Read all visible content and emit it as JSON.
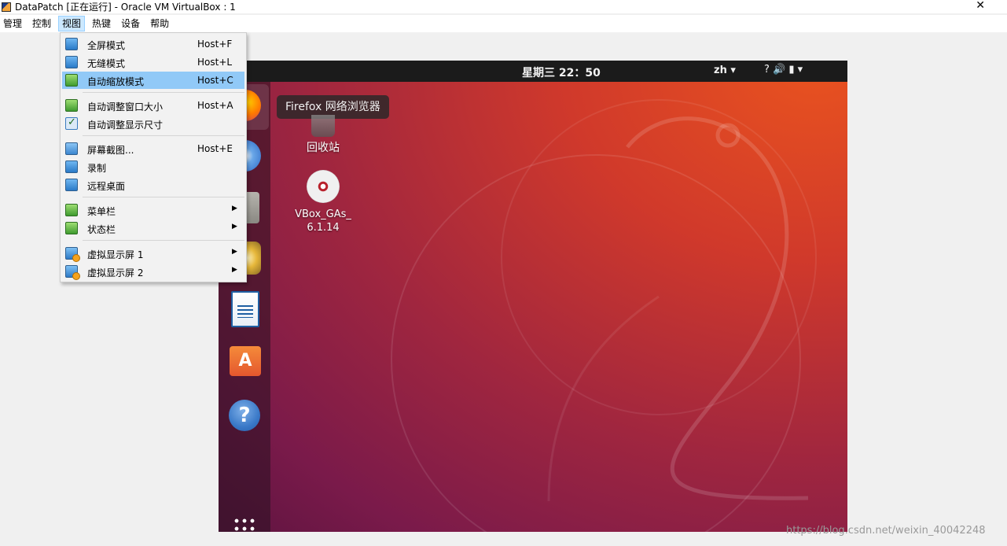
{
  "window": {
    "title": "DataPatch [正在运行] - Oracle VM VirtualBox : 1",
    "close_label": "✕"
  },
  "menubar": {
    "items": [
      "管理",
      "控制",
      "视图",
      "热键",
      "设备",
      "帮助"
    ]
  },
  "view_menu": {
    "items": [
      {
        "label": "全屏模式",
        "shortcut": "Host+F"
      },
      {
        "label": "无缝模式",
        "shortcut": "Host+L"
      },
      {
        "label": "自动缩放模式",
        "shortcut": "Host+C"
      },
      {
        "label": "自动调整窗口大小",
        "shortcut": "Host+A"
      },
      {
        "label": "自动调整显示尺寸",
        "shortcut": ""
      },
      {
        "label": "屏幕截图...",
        "shortcut": "Host+E"
      },
      {
        "label": "录制",
        "shortcut": ""
      },
      {
        "label": "远程桌面",
        "shortcut": ""
      },
      {
        "label": "菜单栏",
        "shortcut": ""
      },
      {
        "label": "状态栏",
        "shortcut": ""
      },
      {
        "label": "虚拟显示屏 1",
        "shortcut": ""
      },
      {
        "label": "虚拟显示屏 2",
        "shortcut": ""
      }
    ],
    "highlighted": "自动缩放模式",
    "submenu_arrow": "▶"
  },
  "guest": {
    "topbar": {
      "activities": "动",
      "clock": "星期三 22：50",
      "lang": "zh ▾",
      "sys_icons": "? 🔊 ▮ ▾"
    },
    "tooltip": "Firefox 网络浏览器",
    "store_glyph": "A",
    "help_glyph": "?",
    "desktop": {
      "trash_label": "回收站",
      "cd_label_line1": "VBox_GAs_",
      "cd_label_line2": "6.1.14"
    }
  },
  "watermark": "https://blog.csdn.net/weixin_40042248"
}
